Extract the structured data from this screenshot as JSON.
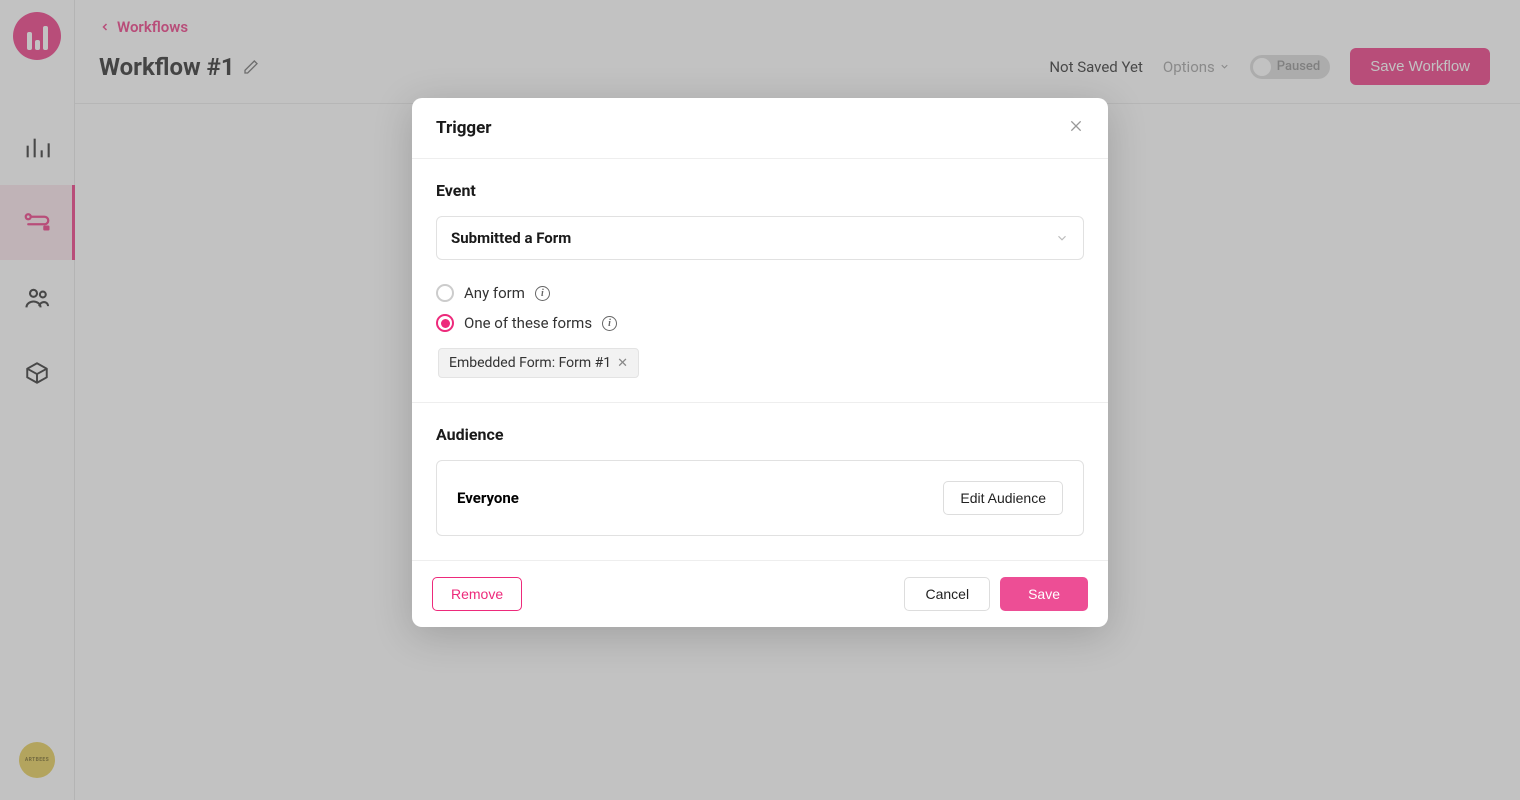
{
  "breadcrumb": {
    "back_label": "Workflows"
  },
  "header": {
    "title": "Workflow #1",
    "not_saved": "Not Saved Yet",
    "options": "Options",
    "toggle_label": "Paused",
    "save_workflow": "Save Workflow"
  },
  "brand_badge": "ARTBEES",
  "modal": {
    "title": "Trigger",
    "event": {
      "label": "Event",
      "selected": "Submitted a Form",
      "radio_any": "Any form",
      "radio_one_of": "One of these forms",
      "selected_form_tag": "Embedded Form: Form #1"
    },
    "audience": {
      "label": "Audience",
      "value": "Everyone",
      "edit_button": "Edit Audience"
    },
    "footer": {
      "remove": "Remove",
      "cancel": "Cancel",
      "save": "Save"
    }
  }
}
